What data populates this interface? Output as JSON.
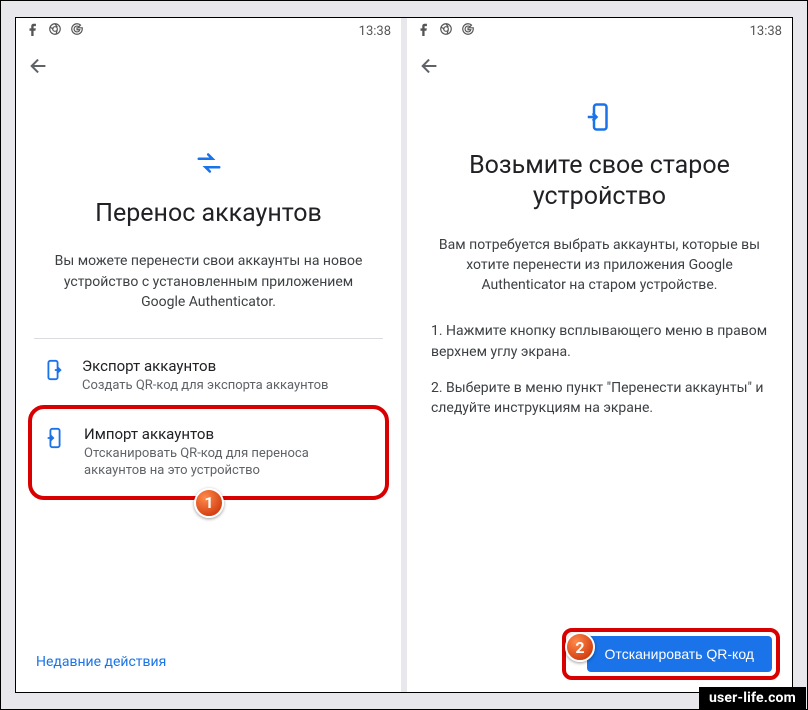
{
  "statusbar": {
    "time": "13:38"
  },
  "left": {
    "title": "Перенос аккаунтов",
    "desc": "Вы можете перенести свои аккаунты на новое устройство с установленным приложением Google Authenticator.",
    "export": {
      "title": "Экспорт аккаунтов",
      "sub": "Создать QR-код для экспорта аккаунтов"
    },
    "import": {
      "title": "Импорт аккаунтов",
      "sub": "Отсканировать QR-код для переноса аккаунтов на это устройство"
    },
    "recent": "Недавние действия"
  },
  "right": {
    "title": "Возьмите свое старое устройство",
    "desc": "Вам потребуется выбрать аккаунты, которые вы хотите перенести из приложения Google Authenticator на старом устройстве.",
    "step1": "1. Нажмите кнопку всплывающего меню в правом верхнем углу экрана.",
    "step2": "2. Выберите в меню пункт \"Перенести аккаунты\" и следуйте инструкциям на экране.",
    "scan": "Отсканировать QR-код"
  },
  "badges": {
    "one": "1",
    "two": "2"
  },
  "watermark": "user-life.com"
}
